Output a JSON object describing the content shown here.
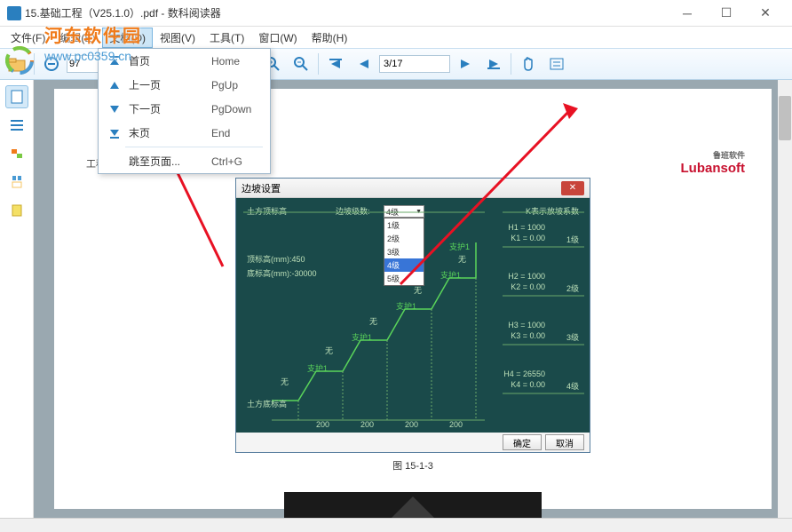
{
  "titlebar": {
    "title": "15.基础工程（V25.1.0）.pdf - 数科阅读器"
  },
  "menubar": {
    "items": [
      "文件(F)",
      "编辑(E)",
      "文档(D)",
      "视图(V)",
      "工具(T)",
      "窗口(W)",
      "帮助(H)"
    ]
  },
  "toolbar": {
    "zoom_value": "97",
    "page_value": "3/17"
  },
  "dropdown": {
    "items": [
      {
        "icon": "▲",
        "label": "首页",
        "shortcut": "Home"
      },
      {
        "icon": "▲",
        "label": "上一页",
        "shortcut": "PgUp"
      },
      {
        "icon": "▼",
        "label": "下一页",
        "shortcut": "PgDown"
      },
      {
        "icon": "▼",
        "label": "末页",
        "shortcut": "End"
      },
      {
        "icon": "",
        "label": "跳至页面...",
        "shortcut": "Ctrl+G"
      }
    ]
  },
  "watermark": {
    "name": "河东软件园",
    "url": "www.pc0359.cn"
  },
  "page": {
    "header": "工程基础数据专家",
    "brand": "Lubansoft",
    "brand_sub": "鲁班软件",
    "figure_caption": "图 15-1-3"
  },
  "dialog": {
    "title": "边坡设置",
    "top_left": "土方顶标高",
    "slope_level_label": "边坡级数:",
    "combo_value": "4级",
    "combo_options": [
      "1级",
      "2级",
      "3级",
      "4级",
      "5级"
    ],
    "k_label": "K表示放坡系数",
    "elev_label1": "顶标高(mm):450",
    "elev_label2": "底标高(mm):-30000",
    "levels": [
      {
        "h": "H1 = 1000",
        "k": "K1 = 0.00",
        "lv": "1级"
      },
      {
        "h": "H2 = 1000",
        "k": "K2 = 0.00",
        "lv": "2级"
      },
      {
        "h": "H3 = 1000",
        "k": "K3 = 0.00",
        "lv": "3级"
      },
      {
        "h": "H4 = 26550",
        "k": "K4 = 0.00",
        "lv": "4级"
      }
    ],
    "wu": "无",
    "zhihu": "支护1",
    "bottom_label": "土方底标高",
    "bottoms": [
      "200",
      "200",
      "200",
      "200"
    ],
    "ok": "确定",
    "cancel": "取消"
  }
}
